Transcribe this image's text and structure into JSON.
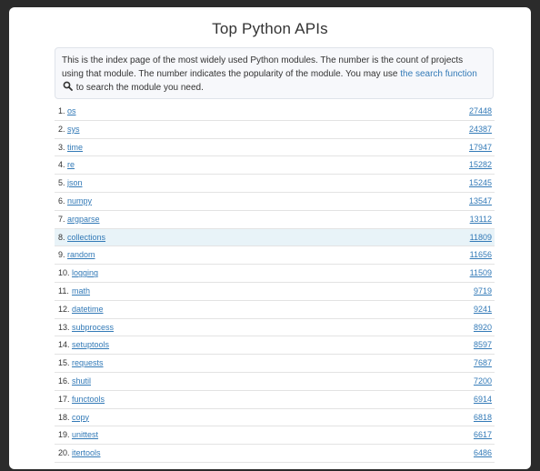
{
  "page": {
    "title": "Top Python APIs"
  },
  "intro": {
    "text_before_link": "This is the index page of the most widely used Python modules. The number is the count of projects using that module. The number indicates the popularity of the module. You may use ",
    "link_text": "the search function",
    "text_after_link": " to search the module you need.",
    "search_icon": "search-icon"
  },
  "modules": [
    {
      "rank": "1.",
      "name": "os",
      "count": "27448"
    },
    {
      "rank": "2.",
      "name": "sys",
      "count": "24387"
    },
    {
      "rank": "3.",
      "name": "time",
      "count": "17947"
    },
    {
      "rank": "4.",
      "name": "re",
      "count": "15282"
    },
    {
      "rank": "5.",
      "name": "json",
      "count": "15245"
    },
    {
      "rank": "6.",
      "name": "numpy",
      "count": "13547"
    },
    {
      "rank": "7.",
      "name": "argparse",
      "count": "13112"
    },
    {
      "rank": "8.",
      "name": "collections",
      "count": "11809"
    },
    {
      "rank": "9.",
      "name": "random",
      "count": "11656"
    },
    {
      "rank": "10.",
      "name": "logging",
      "count": "11509"
    },
    {
      "rank": "11.",
      "name": "math",
      "count": "9719"
    },
    {
      "rank": "12.",
      "name": "datetime",
      "count": "9241"
    },
    {
      "rank": "13.",
      "name": "subprocess",
      "count": "8920"
    },
    {
      "rank": "14.",
      "name": "setuptools",
      "count": "8597"
    },
    {
      "rank": "15.",
      "name": "requests",
      "count": "7687"
    },
    {
      "rank": "16.",
      "name": "shutil",
      "count": "7200"
    },
    {
      "rank": "17.",
      "name": "functools",
      "count": "6914"
    },
    {
      "rank": "18.",
      "name": "copy",
      "count": "6818"
    },
    {
      "rank": "19.",
      "name": "unittest",
      "count": "6617"
    },
    {
      "rank": "20.",
      "name": "itertools",
      "count": "6486"
    }
  ],
  "highlighted_row": 8,
  "colors": {
    "link": "#337ab7",
    "highlight_row": "#e8f3f8",
    "panel_bg": "#f7f8fb"
  }
}
